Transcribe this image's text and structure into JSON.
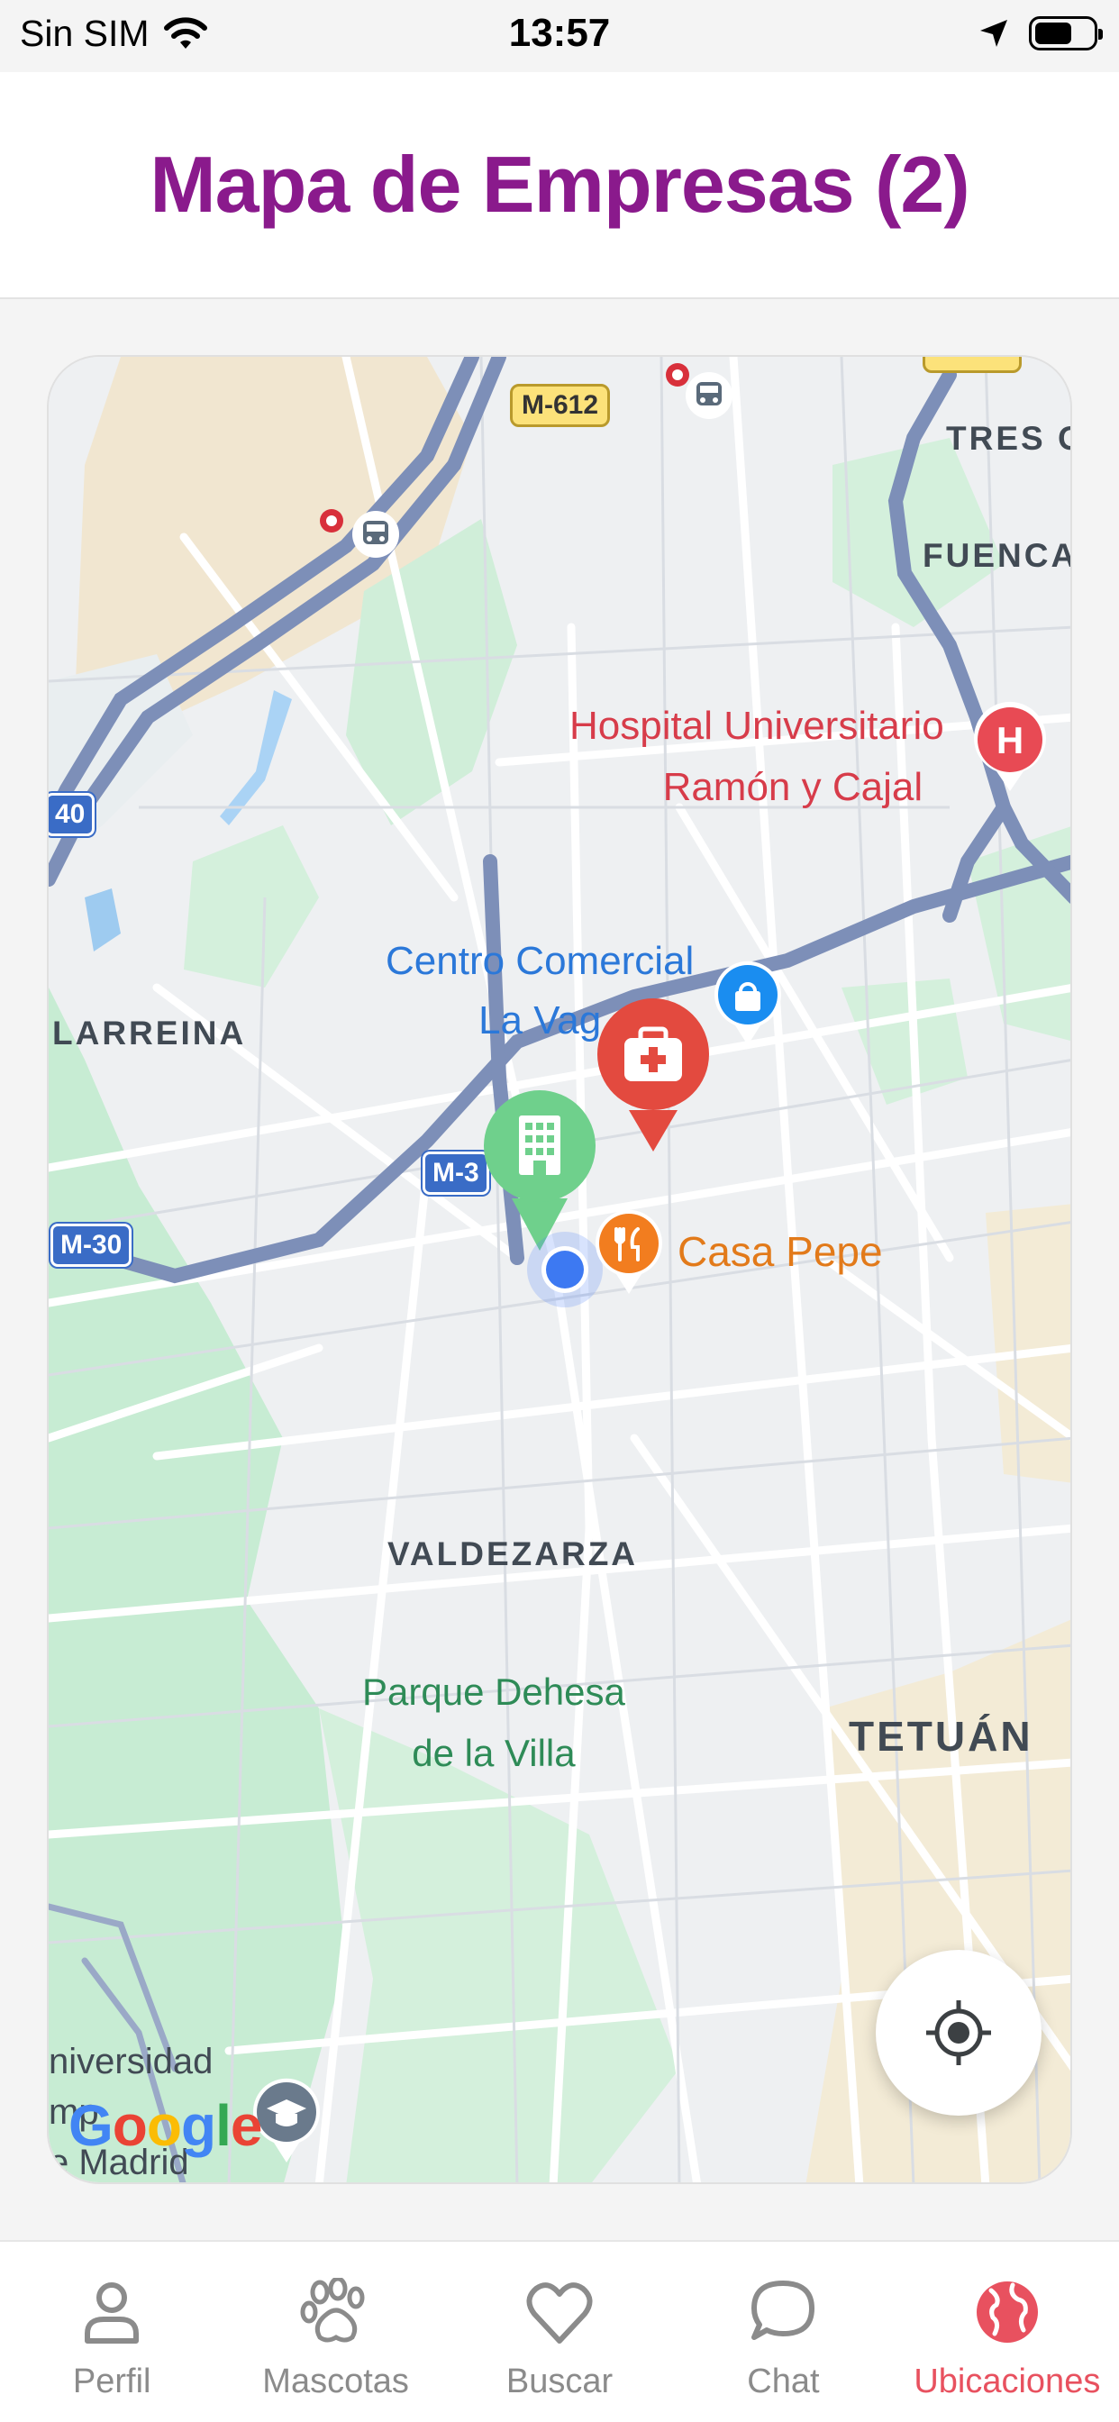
{
  "status_bar": {
    "carrier": "Sin SIM",
    "time": "13:57",
    "icons": [
      "wifi-icon",
      "location-arrow-icon",
      "battery-icon"
    ]
  },
  "header": {
    "title": "Mapa de Empresas (2)"
  },
  "map": {
    "labels": {
      "hospital_line1": "Hospital Universitario",
      "hospital_line2": "Ramón y Cajal",
      "mall_line1": "Centro Comercial",
      "mall_line2": "La Vag",
      "casa_pepe": "Casa Pepe",
      "larreina": "LARREINA",
      "valdezarza": "VALDEZARZA",
      "park_line1": "Parque Dehesa",
      "park_line2": "de la Villa",
      "tetuan": "TETUÁN",
      "tres_o": "TRES O",
      "fuenca": "FUENCA",
      "univ_line1": "niversidad",
      "univ_line2": "mp",
      "univ_line3": "e Madrid"
    },
    "road_shields": {
      "m612": "M-612",
      "m30_a": "M-3",
      "m30_b": "M-30",
      "m40": "40"
    },
    "attribution": "Google",
    "markers": [
      {
        "name": "business-marker-medical",
        "color": "#e34a3f",
        "icon": "medical-kit-icon"
      },
      {
        "name": "business-marker-building",
        "color": "#6fd08c",
        "icon": "building-icon"
      }
    ],
    "colors": {
      "map_bg": "#eef0f2",
      "park": "#c7ecd3",
      "highway": "#7d8fb8",
      "road": "#ffffff"
    }
  },
  "tabs": [
    {
      "label": "Perfil",
      "icon": "person-icon",
      "active": false
    },
    {
      "label": "Mascotas",
      "icon": "paw-icon",
      "active": false
    },
    {
      "label": "Buscar",
      "icon": "heart-icon",
      "active": false
    },
    {
      "label": "Chat",
      "icon": "chat-bubble-icon",
      "active": false
    },
    {
      "label": "Ubicaciones",
      "icon": "globe-icon",
      "active": true
    }
  ],
  "theme": {
    "title_color": "#8a1a8c",
    "active_tab_color": "#e8515f",
    "inactive_tab_color": "#8b8b8b"
  }
}
